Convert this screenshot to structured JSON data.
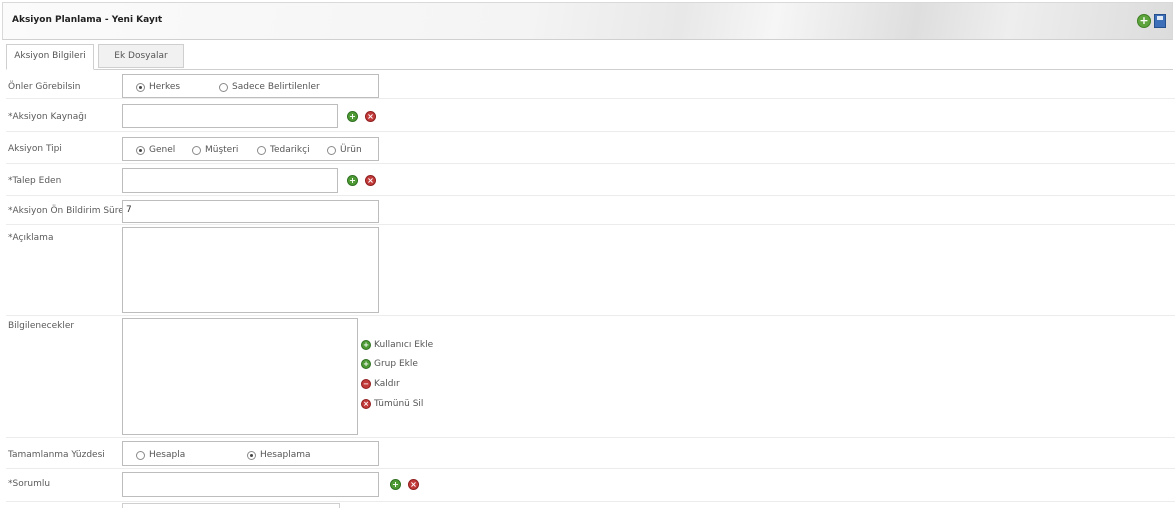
{
  "window": {
    "title": "Aksiyon Planlama - Yeni Kayıt",
    "icons": [
      "add-icon",
      "save-icon"
    ]
  },
  "tabs": [
    {
      "label": "Aksiyon Bilgileri",
      "active": true
    },
    {
      "label": "Ek Dosyalar",
      "active": false
    }
  ],
  "form": {
    "visibility": {
      "label": "Önler Görebilsin",
      "options": [
        {
          "label": "Herkes",
          "selected": true
        },
        {
          "label": "Sadece Belirtilenler",
          "selected": false
        }
      ]
    },
    "source": {
      "label": "*Aksiyon Kaynağı",
      "value": ""
    },
    "type": {
      "label": "Aksiyon Tipi",
      "options": [
        {
          "label": "Genel",
          "selected": true
        },
        {
          "label": "Müşteri",
          "selected": false
        },
        {
          "label": "Tedarikçi",
          "selected": false
        },
        {
          "label": "Ürün",
          "selected": false
        }
      ]
    },
    "requester": {
      "label": "*Talep Eden",
      "value": ""
    },
    "notice_period": {
      "label": "*Aksiyon Ön Bildirim Süresi",
      "value": "7"
    },
    "description": {
      "label": "*Açıklama",
      "value": ""
    },
    "notified": {
      "label": "Bilgilenecekler",
      "actions": [
        "Kullanıcı Ekle",
        "Grup Ekle",
        "Kaldır",
        "Tümünü Sil"
      ]
    },
    "completion": {
      "label": "Tamamlanma Yüzdesi",
      "options": [
        {
          "label": "Hesapla",
          "selected": false
        },
        {
          "label": "Hesaplama",
          "selected": true
        }
      ]
    },
    "responsible": {
      "label": "*Sorumlu",
      "value": ""
    }
  },
  "colors": {
    "add_green": "#4e9b35",
    "delete_red": "#c23a3a",
    "border": "#bdbdbd"
  }
}
